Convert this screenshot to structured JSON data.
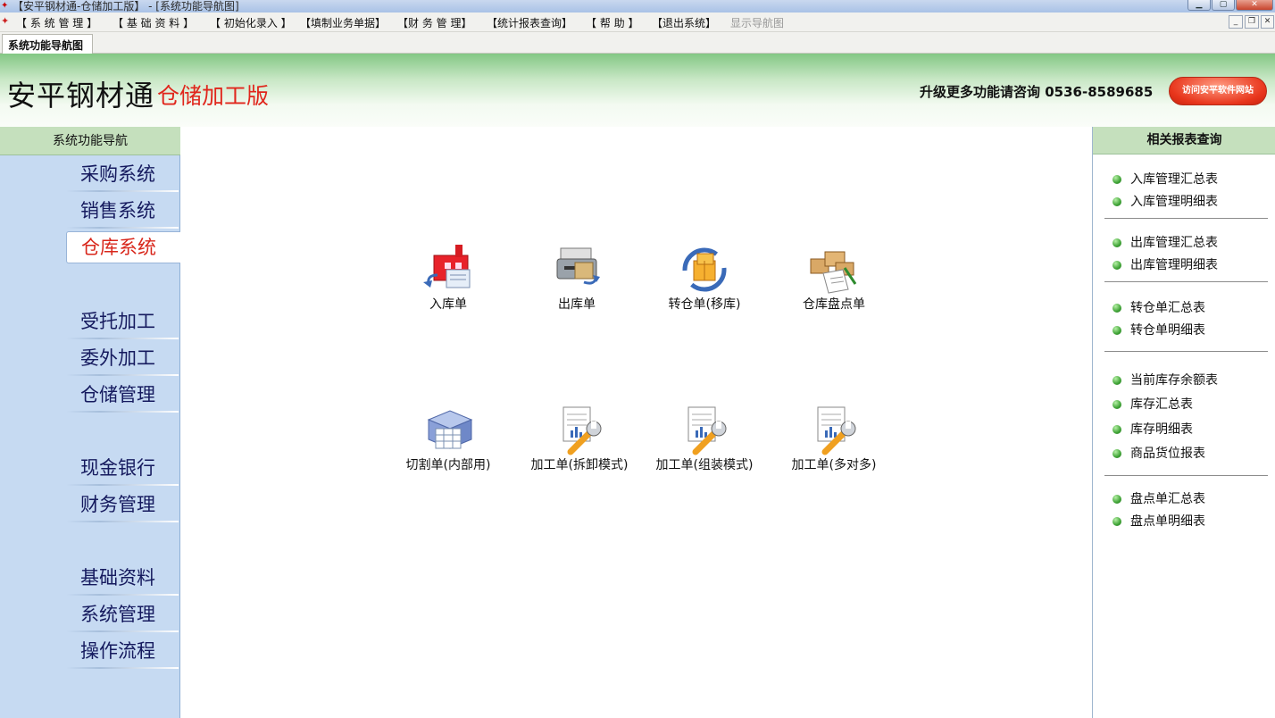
{
  "window": {
    "title": "【安平钢材通-仓储加工版】 - [系统功能导航图]"
  },
  "menu": [
    "【 系 统 管 理 】",
    "【 基 础 资 料 】",
    "【 初始化录入 】",
    "【填制业务单据】",
    "【财 务 管 理】",
    "【统计报表查询】",
    "【 帮 助 】",
    "【退出系统】"
  ],
  "menu_extra": "显示导航图",
  "tab": "系统功能导航图",
  "banner": {
    "brand": "安平钢材通",
    "edition": "仓储加工版",
    "contact": "升级更多功能请咨询 0536-8589685",
    "visit_button": "访问安平软件网站"
  },
  "left_nav": {
    "header": "系统功能导航",
    "items": [
      "采购系统",
      "销售系统",
      "仓库系统",
      "受托加工",
      "委外加工",
      "仓储管理",
      "现金银行",
      "财务管理",
      "基础资料",
      "系统管理",
      "操作流程"
    ],
    "active": "仓库系统"
  },
  "tools": [
    "入库单",
    "出库单",
    "转仓单(移库)",
    "仓库盘点单",
    "切割单(内部用)",
    "加工单(拆卸模式)",
    "加工单(组装模式)",
    "加工单(多对多)"
  ],
  "right_panel": {
    "header": "相关报表查询",
    "groups": [
      [
        "入库管理汇总表",
        "入库管理明细表"
      ],
      [
        "出库管理汇总表",
        "出库管理明细表"
      ],
      [
        "转仓单汇总表",
        "转仓单明细表"
      ],
      [
        "当前库存余额表",
        "库存汇总表",
        "库存明细表",
        "商品货位报表"
      ],
      [
        "盘点单汇总表",
        "盘点单明细表"
      ]
    ]
  },
  "colors": {
    "nav_text": "#151a5e",
    "active_text": "#d8261b",
    "edition_red": "#e0261c",
    "left_bg": "#c6daf2",
    "header_green": "#c5e0bd"
  }
}
